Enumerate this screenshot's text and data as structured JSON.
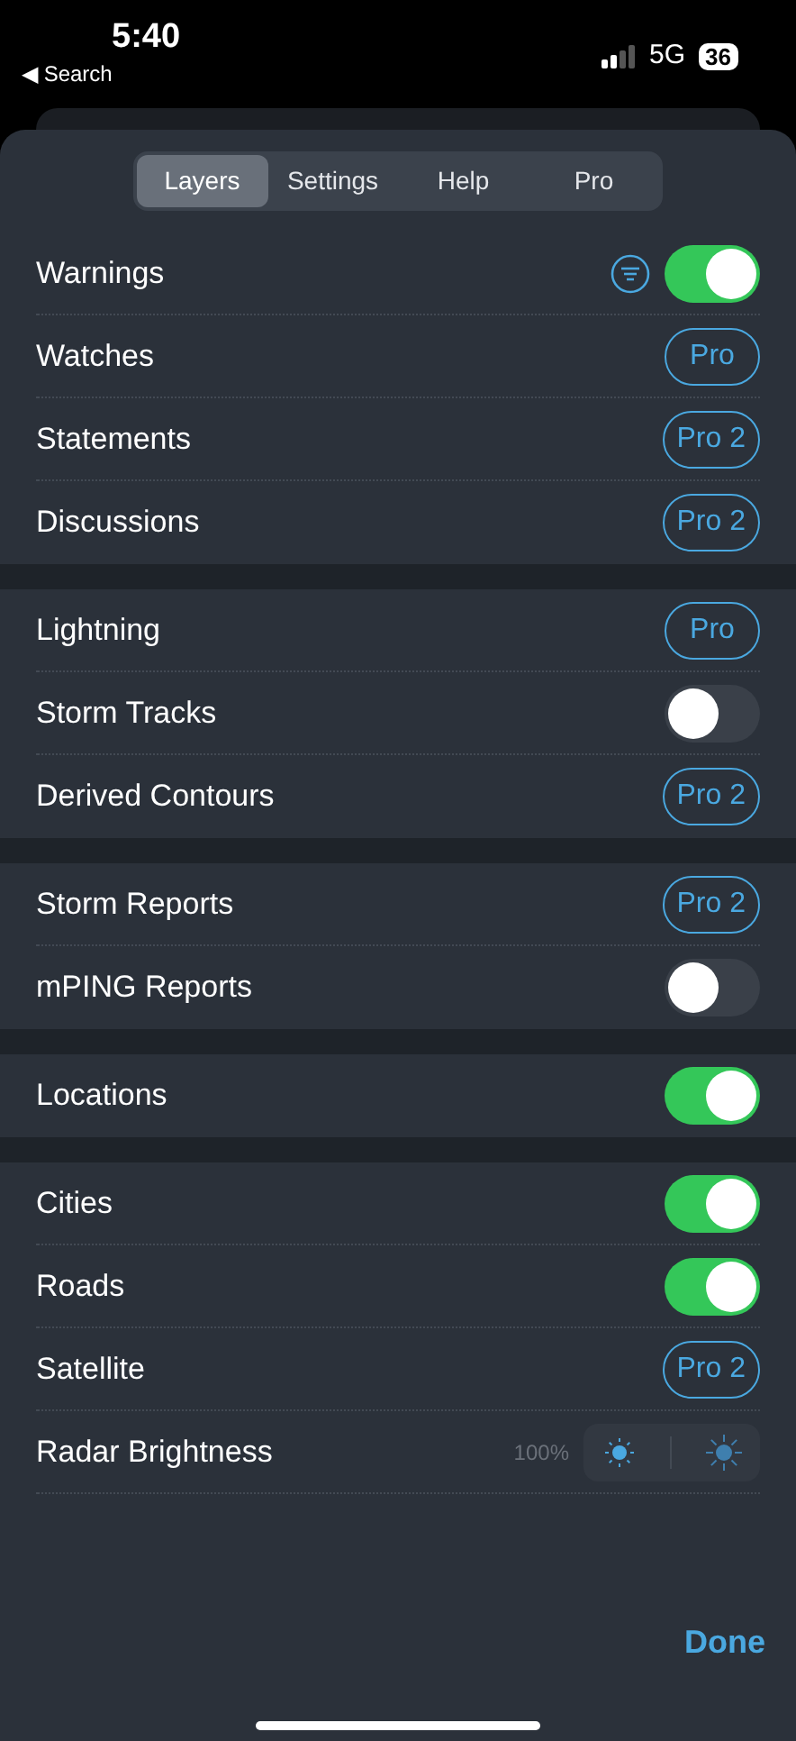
{
  "status_bar": {
    "time": "5:40",
    "back_label": "◀ Search",
    "network": "5G",
    "battery": "36"
  },
  "tabs": [
    {
      "label": "Layers",
      "selected": true
    },
    {
      "label": "Settings",
      "selected": false
    },
    {
      "label": "Help",
      "selected": false
    },
    {
      "label": "Pro",
      "selected": false
    }
  ],
  "sections": [
    {
      "rows": [
        {
          "label": "Warnings",
          "kind": "toggle",
          "on": true,
          "filter_button": true
        },
        {
          "label": "Watches",
          "kind": "badge",
          "badge": "Pro"
        },
        {
          "label": "Statements",
          "kind": "badge",
          "badge": "Pro 2"
        },
        {
          "label": "Discussions",
          "kind": "badge",
          "badge": "Pro 2"
        }
      ]
    },
    {
      "rows": [
        {
          "label": "Lightning",
          "kind": "badge",
          "badge": "Pro"
        },
        {
          "label": "Storm Tracks",
          "kind": "toggle",
          "on": false
        },
        {
          "label": "Derived Contours",
          "kind": "badge",
          "badge": "Pro 2"
        }
      ]
    },
    {
      "rows": [
        {
          "label": "Storm Reports",
          "kind": "badge",
          "badge": "Pro 2"
        },
        {
          "label": "mPING Reports",
          "kind": "toggle",
          "on": false
        }
      ]
    },
    {
      "rows": [
        {
          "label": "Locations",
          "kind": "toggle",
          "on": true
        }
      ]
    },
    {
      "rows": [
        {
          "label": "Cities",
          "kind": "toggle",
          "on": true
        },
        {
          "label": "Roads",
          "kind": "toggle",
          "on": true
        },
        {
          "label": "Satellite",
          "kind": "badge",
          "badge": "Pro 2"
        },
        {
          "label": "Radar Brightness",
          "kind": "brightness",
          "reading": "100%"
        }
      ]
    }
  ],
  "done_button": "Done"
}
